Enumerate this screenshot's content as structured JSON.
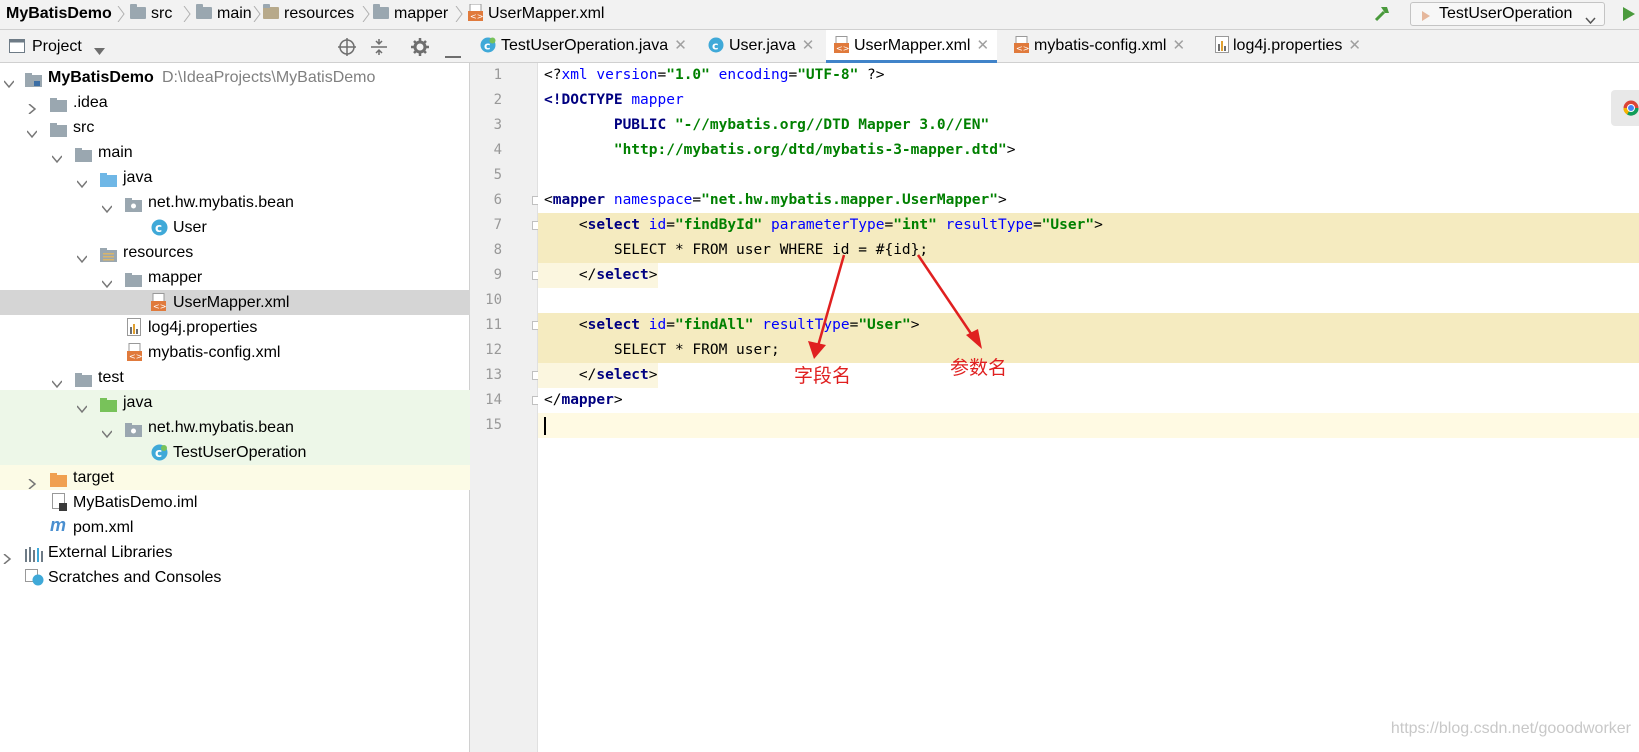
{
  "breadcrumb": {
    "project": "MyBatisDemo",
    "items": [
      "src",
      "main",
      "resources",
      "mapper",
      "UserMapper.xml"
    ]
  },
  "run_config": {
    "name": "TestUserOperation"
  },
  "project_panel": {
    "title": "Project"
  },
  "tree": [
    {
      "label": "MyBatisDemo",
      "hint": "D:\\IdeaProjects\\MyBatisDemo",
      "icon": "module-folder-icon",
      "expanded": true
    },
    {
      "label": ".idea",
      "icon": "folder-icon",
      "expanded": false
    },
    {
      "label": "src",
      "icon": "folder-icon",
      "expanded": true
    },
    {
      "label": "main",
      "icon": "folder-icon",
      "expanded": true
    },
    {
      "label": "java",
      "icon": "source-folder-icon",
      "expanded": true
    },
    {
      "label": "net.hw.mybatis.bean",
      "icon": "package-icon",
      "expanded": true
    },
    {
      "label": "User",
      "icon": "class-icon"
    },
    {
      "label": "resources",
      "icon": "resources-folder-icon",
      "expanded": true
    },
    {
      "label": "mapper",
      "icon": "folder-icon",
      "expanded": true
    },
    {
      "label": "UserMapper.xml",
      "icon": "xml-file-icon",
      "selected": true
    },
    {
      "label": "log4j.properties",
      "icon": "properties-file-icon"
    },
    {
      "label": "mybatis-config.xml",
      "icon": "xml-file-icon"
    },
    {
      "label": "test",
      "icon": "folder-icon",
      "expanded": true
    },
    {
      "label": "java",
      "icon": "test-source-folder-icon",
      "expanded": true
    },
    {
      "label": "net.hw.mybatis.bean",
      "icon": "package-icon",
      "expanded": true
    },
    {
      "label": "TestUserOperation",
      "icon": "test-class-icon"
    },
    {
      "label": "target",
      "icon": "excluded-folder-icon",
      "expanded": false
    },
    {
      "label": "MyBatisDemo.iml",
      "icon": "iml-file-icon"
    },
    {
      "label": "pom.xml",
      "icon": "maven-file-icon"
    },
    {
      "label": "External Libraries",
      "icon": "libraries-icon",
      "expanded": false
    },
    {
      "label": "Scratches and Consoles",
      "icon": "scratches-icon"
    }
  ],
  "tabs": [
    {
      "label": "TestUserOperation.java",
      "icon": "test-class-icon"
    },
    {
      "label": "User.java",
      "icon": "class-icon"
    },
    {
      "label": "UserMapper.xml",
      "icon": "xml-file-icon",
      "active": true
    },
    {
      "label": "mybatis-config.xml",
      "icon": "xml-file-icon"
    },
    {
      "label": "log4j.properties",
      "icon": "properties-file-icon"
    }
  ],
  "line_numbers": [
    "1",
    "2",
    "3",
    "4",
    "5",
    "6",
    "7",
    "8",
    "9",
    "10",
    "11",
    "12",
    "13",
    "14",
    "15"
  ],
  "code": {
    "l1": {
      "a": "<?",
      "b": "xml ",
      "c": "version",
      "d": "=",
      "e": "\"1.0\" ",
      "f": "encoding",
      "g": "=",
      "h": "\"UTF-8\"",
      "i": " ?>"
    },
    "l2": {
      "a": "<!DOCTYPE ",
      "b": "mapper"
    },
    "l3": {
      "a": "        PUBLIC ",
      "b": "\"-//mybatis.org//DTD Mapper 3.0//EN\""
    },
    "l4": {
      "a": "        ",
      "b": "\"http://mybatis.org/dtd/mybatis-3-mapper.dtd\"",
      "c": ">"
    },
    "l6": {
      "a": "<",
      "b": "mapper ",
      "c": "namespace",
      "d": "=",
      "e": "\"net.hw.mybatis.mapper.UserMapper\"",
      "f": ">"
    },
    "l7": {
      "a": "    <",
      "b": "select ",
      "c": "id",
      "d": "=",
      "e": "\"findById\" ",
      "f": "parameterType",
      "g": "=",
      "h": "\"int\" ",
      "i": "resultType",
      "j": "=",
      "k": "\"User\"",
      "l": ">"
    },
    "l8": {
      "a": "        SELECT * FROM user WHERE id = #{id};"
    },
    "l9": {
      "a": "    </",
      "b": "select",
      "c": ">"
    },
    "l11": {
      "a": "    <",
      "b": "select ",
      "c": "id",
      "d": "=",
      "e": "\"findAll\" ",
      "f": "resultType",
      "g": "=",
      "h": "\"User\"",
      "i": ">"
    },
    "l12": {
      "a": "        SELECT * FROM user;"
    },
    "l13": {
      "a": "    </",
      "b": "select",
      "c": ">"
    },
    "l14": {
      "a": "</",
      "b": "mapper",
      "c": ">"
    }
  },
  "annotations": {
    "field_name": "字段名",
    "param_name": "参数名"
  },
  "watermark": "https://blog.csdn.net/gooodworker",
  "colors": {
    "accent": "#4083c9",
    "highlight": "#f5ebc0",
    "annotation": "#e02020"
  }
}
